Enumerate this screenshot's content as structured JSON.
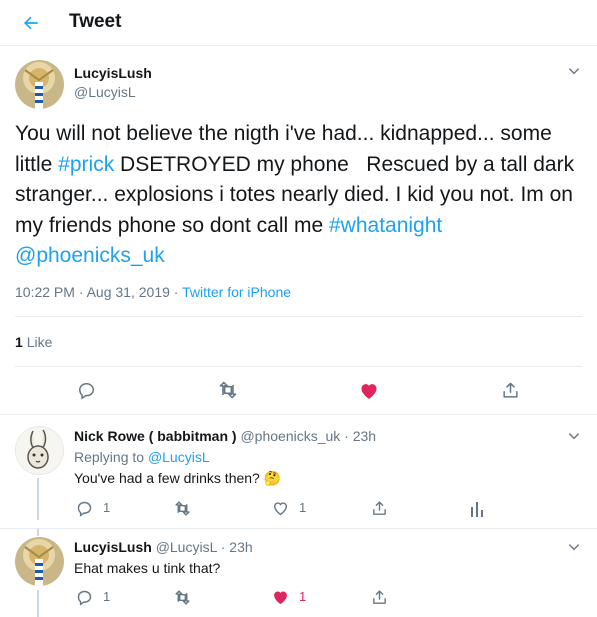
{
  "header": {
    "title": "Tweet"
  },
  "main_tweet": {
    "name": "LucyisLush",
    "handle": "@LucyisL",
    "text_part1": "You will not believe the nigth i've had... kidnapped... some little ",
    "hashtag1": "#prick",
    "text_part2": " DSETROYED my phone   Rescued by a tall dark stranger... explosions i totes nearly died. I kid you not. Im on my friends phone so dont call me ",
    "hashtag2": "#whatanight",
    "mention": "@phoenicks_uk",
    "timestamp": "10:22 PM · Aug 31, 2019 · ",
    "source": "Twitter for iPhone",
    "like_count": "1",
    "like_label": "Like"
  },
  "replies": [
    {
      "name": "Nick Rowe ( babbitman )",
      "handle_time": "@phoenicks_uk · 23h",
      "replying_label": "Replying to ",
      "replying_handle": "@LucyisL",
      "text": "You've had a few drinks then? 🤔",
      "reply_count": "1",
      "like_count": "1"
    },
    {
      "name": "LucyisLush",
      "handle_time": "@LucyisL · 23h",
      "text": "Ehat makes u tink that?",
      "reply_count": "1",
      "like_count": "1"
    }
  ],
  "colors": {
    "accent": "#1da1f2",
    "like": "#e0245e",
    "muted": "#657786"
  }
}
